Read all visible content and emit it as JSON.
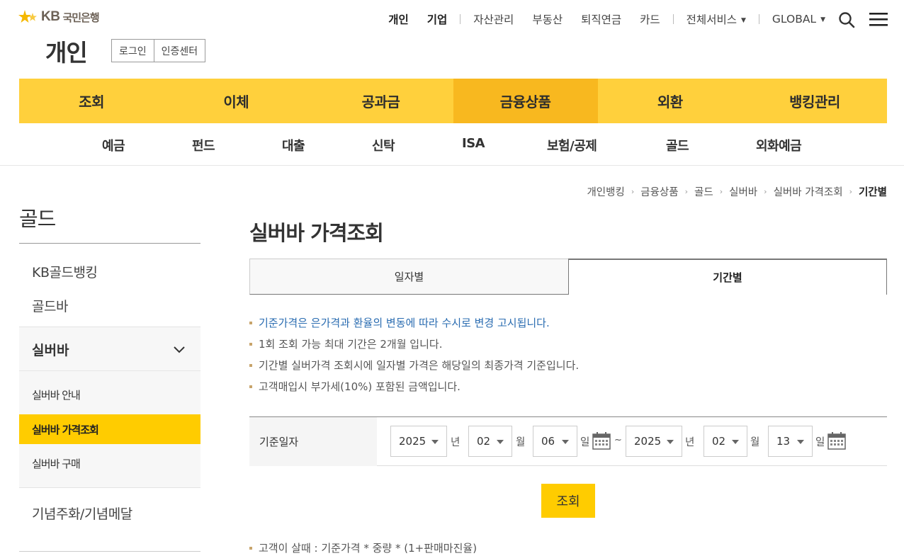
{
  "header": {
    "logo_kb": "KB",
    "logo_bank": "국민은행",
    "section_title": "개인",
    "auth": {
      "login": "로그인",
      "cert": "인증센터"
    },
    "topnav": {
      "personal": "개인",
      "corporate": "기업",
      "asset": "자산관리",
      "realestate": "부동산",
      "pension": "퇴직연금",
      "card": "카드",
      "all_services": "전체서비스",
      "global": "GLOBAL"
    }
  },
  "mainnav": [
    "조회",
    "이체",
    "공과금",
    "금융상품",
    "외환",
    "뱅킹관리"
  ],
  "subnav": [
    "예금",
    "펀드",
    "대출",
    "신탁",
    "ISA",
    "보험/공제",
    "골드",
    "외화예금"
  ],
  "breadcrumb": [
    "개인뱅킹",
    "금융상품",
    "골드",
    "실버바",
    "실버바 가격조회",
    "기간별"
  ],
  "lnb": {
    "title": "골드",
    "items": [
      "KB골드뱅킹",
      "골드바"
    ],
    "open_group": "실버바",
    "sub_items": [
      "실버바 안내",
      "실버바 가격조회",
      "실버바 구매"
    ],
    "last_item": "기념주화/기념메달"
  },
  "content": {
    "title": "실버바 가격조회",
    "tabs": {
      "daily": "일자별",
      "period": "기간별"
    },
    "notes": [
      "기준가격은 은가격과 환율의 변동에 따라 수시로 변경 고시됩니다.",
      "1회 조회 가능 최대 기간은 2개월 입니다.",
      "기간별 실버가격 조회시에 일자별 가격은 해당일의 최종가격 기준입니다.",
      "고객매입시 부가세(10%) 포함된 금액입니다."
    ],
    "search": {
      "label": "기준일자",
      "from": {
        "year": "2025",
        "month": "02",
        "day": "06"
      },
      "to": {
        "year": "2025",
        "month": "02",
        "day": "13"
      },
      "unit_year": "년",
      "unit_month": "월",
      "unit_day": "일",
      "tilde": "~"
    },
    "query_button": "조회",
    "bottom_note": "고객이 살때 : 기준가격 * 중량 * (1+판매마진율)"
  },
  "colors": {
    "nav_yellow": "#ffd03c",
    "nav_active": "#f8b81f",
    "accent": "#ffcc00",
    "notice_blue": "#2a6cb1"
  }
}
